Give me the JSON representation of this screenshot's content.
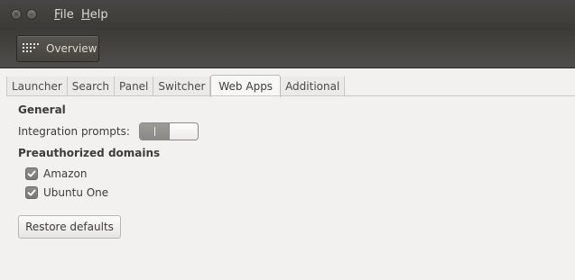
{
  "window": {
    "buttons": [
      {
        "name": "close",
        "glyph": "×"
      },
      {
        "name": "minimize",
        "glyph": "–"
      }
    ]
  },
  "menu": {
    "file_mnemonic": "F",
    "file_rest": "ile",
    "help_mnemonic": "H",
    "help_rest": "elp"
  },
  "toolbar": {
    "overview_label": "Overview",
    "overview_icon": "grid-icon"
  },
  "tabs": [
    {
      "label": "Launcher",
      "active": false
    },
    {
      "label": "Search",
      "active": false
    },
    {
      "label": "Panel",
      "active": false
    },
    {
      "label": "Switcher",
      "active": false
    },
    {
      "label": "Web Apps",
      "active": true
    },
    {
      "label": "Additional",
      "active": false
    }
  ],
  "general": {
    "heading": "General",
    "integration_label": "Integration prompts:",
    "integration_on": true
  },
  "domains": {
    "heading": "Preauthorized domains",
    "items": [
      {
        "label": "Amazon",
        "checked": true
      },
      {
        "label": "Ubuntu One",
        "checked": true
      }
    ]
  },
  "restore_label": "Restore defaults",
  "colors": {
    "menubar_bg": "#3c3b37",
    "menu_text": "#dfdbd2",
    "window_bg": "#f2f1f0",
    "checkbox_fill": "#8a8884"
  }
}
